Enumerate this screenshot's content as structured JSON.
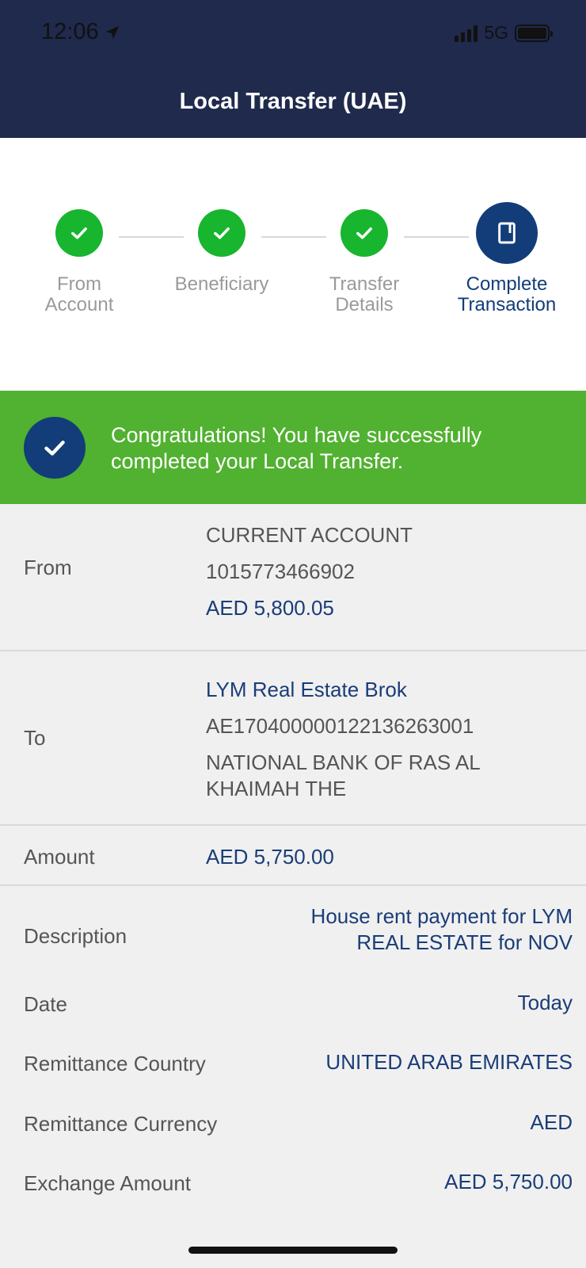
{
  "status_bar": {
    "time": "12:06",
    "network": "5G"
  },
  "header": {
    "title": "Local Transfer (UAE)"
  },
  "stepper": {
    "steps": [
      {
        "label_line1": "From",
        "label_line2": "Account",
        "state": "done"
      },
      {
        "label_line1": "Beneficiary",
        "label_line2": "",
        "state": "done"
      },
      {
        "label_line1": "Transfer",
        "label_line2": "Details",
        "state": "done"
      },
      {
        "label_line1": "Complete",
        "label_line2": "Transaction",
        "state": "active"
      }
    ]
  },
  "banner": {
    "line1": "Congratulations! You have successfully",
    "line2": "completed your Local Transfer."
  },
  "details": {
    "from": {
      "label": "From",
      "account_type": "CURRENT ACCOUNT",
      "account_number": "1015773466902",
      "balance": "AED 5,800.05"
    },
    "to": {
      "label": "To",
      "name": "LYM Real Estate Brok",
      "iban": "AE170400000122136263001",
      "bank_line1": "NATIONAL BANK OF RAS AL",
      "bank_line2": "KHAIMAH  THE"
    },
    "amount": {
      "label": "Amount",
      "value": "AED 5,750.00"
    },
    "description": {
      "label": "Description",
      "line1": "House rent payment for LYM",
      "line2": "REAL ESTATE for NOV"
    },
    "date": {
      "label": "Date",
      "value": "Today"
    },
    "remittance_country": {
      "label": "Remittance Country",
      "value": "UNITED ARAB EMIRATES"
    },
    "remittance_currency": {
      "label": "Remittance Currency",
      "value": "AED"
    },
    "exchange_amount": {
      "label": "Exchange Amount",
      "value": "AED 5,750.00"
    }
  },
  "colors": {
    "header_bg": "#1f2a4d",
    "step_done": "#18b52e",
    "step_active": "#123d79",
    "banner_bg": "#51b130",
    "value_blue": "#1a3d78"
  }
}
